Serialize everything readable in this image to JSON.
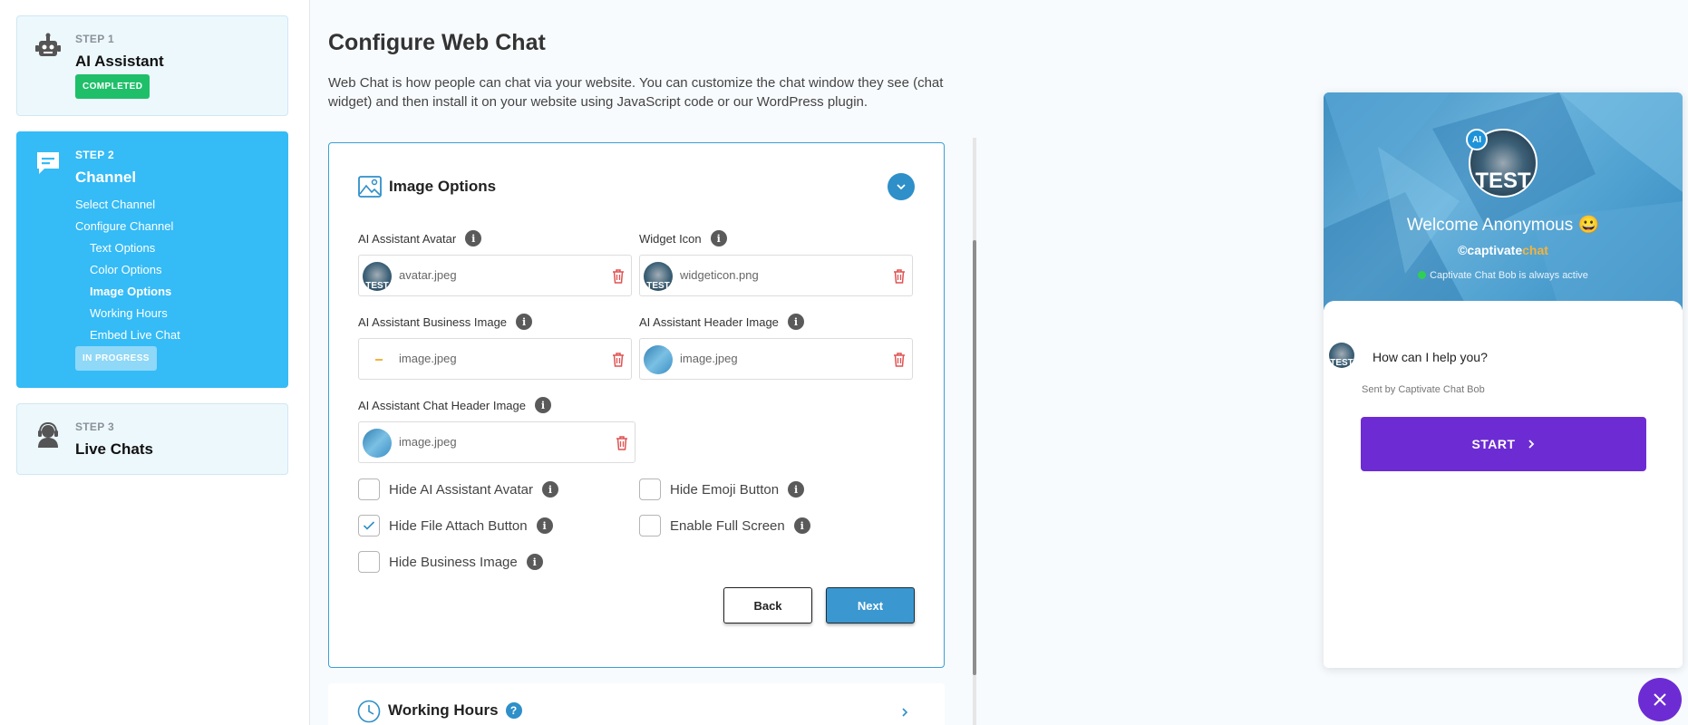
{
  "sidebar": {
    "step1": {
      "num": "STEP 1",
      "title": "AI Assistant",
      "badge": "COMPLETED"
    },
    "step2": {
      "num": "STEP 2",
      "title": "Channel",
      "items": [
        "Select Channel",
        "Configure Channel",
        "Text Options",
        "Color Options",
        "Image Options",
        "Working Hours",
        "Embed Live Chat"
      ],
      "badge": "IN PROGRESS"
    },
    "step3": {
      "num": "STEP 3",
      "title": "Live Chats"
    }
  },
  "main": {
    "title": "Configure Web Chat",
    "description": "Web Chat is how people can chat via your website. You can customize the chat window they see (chat widget) and then install it on your website using JavaScript code or our WordPress plugin."
  },
  "image_options": {
    "title": "Image Options",
    "fields": {
      "avatar": {
        "label": "AI Assistant Avatar",
        "file": "avatar.jpeg"
      },
      "widget_icon": {
        "label": "Widget Icon",
        "file": "widgeticon.png"
      },
      "business_image": {
        "label": "AI Assistant Business Image",
        "file": "image.jpeg"
      },
      "header_image": {
        "label": "AI Assistant Header Image",
        "file": "image.jpeg"
      },
      "chat_header_image": {
        "label": "AI Assistant Chat Header Image",
        "file": "image.jpeg"
      }
    },
    "thumb_text": "TEST",
    "checkboxes": {
      "hide_avatar": {
        "label": "Hide AI Assistant Avatar",
        "checked": false
      },
      "hide_emoji": {
        "label": "Hide Emoji Button",
        "checked": false
      },
      "hide_file_attach": {
        "label": "Hide File Attach Button",
        "checked": true
      },
      "full_screen": {
        "label": "Enable Full Screen",
        "checked": false
      },
      "hide_business_image": {
        "label": "Hide Business Image",
        "checked": false
      }
    },
    "buttons": {
      "back": "Back",
      "next": "Next"
    }
  },
  "working_hours": {
    "title": "Working Hours"
  },
  "chat_preview": {
    "ai_badge": "AI",
    "avatar_text": "TEST",
    "welcome": "Welcome Anonymous 😀",
    "brand_captivate": "captivate",
    "brand_chat": "chat",
    "active_text": "Captivate Chat Bob is always active",
    "message": "How can I help you?",
    "sent_by": "Sent by Captivate Chat Bob",
    "start_label": "START"
  },
  "colors": {
    "accent": "#35bbf6",
    "primary_blue": "#3b97cf",
    "success": "#1fbf6a",
    "chat_purple": "#6d2cd3"
  }
}
